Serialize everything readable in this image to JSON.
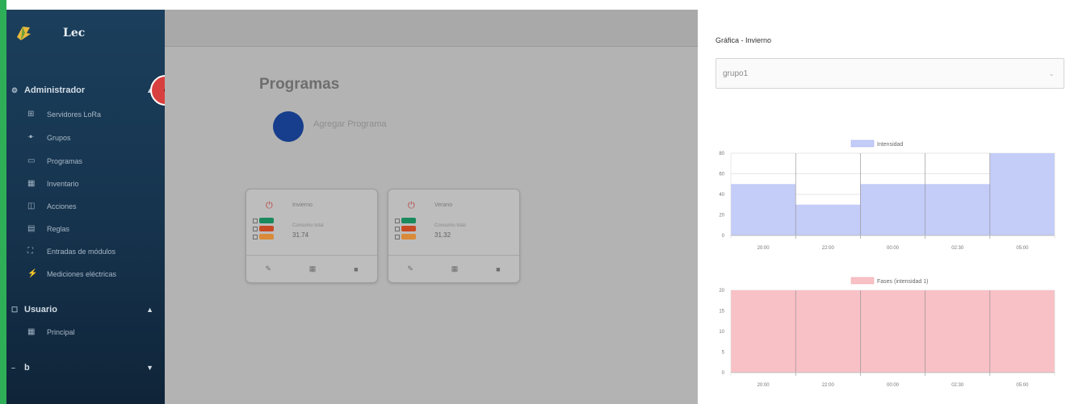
{
  "brand": {
    "name": "Lec",
    "logo_icon": "leaf-logo-icon"
  },
  "sidebar": {
    "sections": [
      {
        "label": "Administrador",
        "icon": "gear-icon",
        "expanded": true,
        "items": [
          {
            "label": "Servidores LoRa",
            "icon": "grid-icon"
          },
          {
            "label": "Grupos",
            "icon": "users-icon"
          },
          {
            "label": "Programas",
            "icon": "window-icon"
          },
          {
            "label": "Inventario",
            "icon": "table-icon"
          },
          {
            "label": "Acciones",
            "icon": "box-icon"
          },
          {
            "label": "Reglas",
            "icon": "list-icon"
          },
          {
            "label": "Entradas de módulos",
            "icon": "expand-icon"
          },
          {
            "label": "Mediciones eléctricas",
            "icon": "plug-icon"
          }
        ]
      },
      {
        "label": "Usuario",
        "icon": "user-icon",
        "expanded": true,
        "items": [
          {
            "label": "Principal",
            "icon": "table-icon"
          }
        ]
      },
      {
        "label": "b",
        "icon": "dash-icon",
        "expanded": false,
        "items": []
      }
    ]
  },
  "main": {
    "title": "Programas",
    "add_label": "Agregar Programa",
    "cards": [
      {
        "title": "Invierno",
        "subtitle": "Consumo total",
        "value": "31.74",
        "badge_colors": [
          "#1a8a5e",
          "#c84a24",
          "#d98b3a"
        ]
      },
      {
        "title": "Verano",
        "subtitle": "Consumo total",
        "value": "31.32",
        "badge_colors": [
          "#1a8a5e",
          "#c84a24",
          "#d98b3a"
        ]
      }
    ],
    "card_actions": [
      "edit-icon",
      "calendar-icon",
      "delete-icon"
    ]
  },
  "panel": {
    "title": "Gráfica - Invierno",
    "select": {
      "value": "grupo1"
    }
  },
  "chart_data": [
    {
      "type": "area",
      "step": true,
      "legend": [
        "Intensidad"
      ],
      "x": [
        "20:00",
        "22:00",
        "00:00",
        "02:30",
        "05:00"
      ],
      "series": [
        {
          "name": "Intensidad",
          "values": [
            50,
            30,
            50,
            50,
            80
          ],
          "color": "#c4cdf8"
        }
      ],
      "ylim": [
        0,
        80
      ],
      "yticks": [
        0,
        20,
        40,
        60,
        80
      ],
      "grid": true
    },
    {
      "type": "area",
      "step": true,
      "legend": [
        "Fases (intensidad 1)"
      ],
      "x": [
        "20:00",
        "22:00",
        "00:00",
        "02:30",
        "05:00"
      ],
      "series": [
        {
          "name": "Fases (intensidad 1)",
          "values": [
            20,
            20,
            20,
            20,
            20
          ],
          "color": "#f8c1c6"
        }
      ],
      "ylim": [
        0,
        20
      ],
      "yticks": [
        0,
        5,
        10,
        15,
        20
      ],
      "grid": true
    }
  ],
  "colors": {
    "accent": "#2fae58",
    "sidebar": "#1b3f5c",
    "fab_red": "#d8403f",
    "fab_blue": "#163e8c"
  }
}
